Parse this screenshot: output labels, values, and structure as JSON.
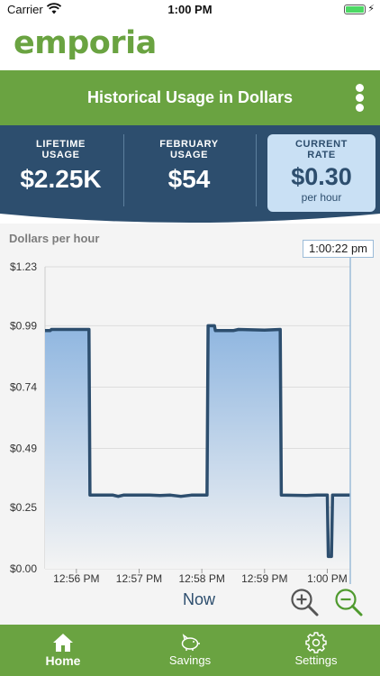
{
  "status_bar": {
    "carrier": "Carrier",
    "time": "1:00 PM"
  },
  "app": {
    "logo": "emporia"
  },
  "header": {
    "title": "Historical Usage in Dollars",
    "menu_icon": "kebab-menu-icon"
  },
  "stats": {
    "lifetime": {
      "label_line1": "LIFETIME",
      "label_line2": "USAGE",
      "value": "$2.25K"
    },
    "month": {
      "label_line1": "FEBRUARY",
      "label_line2": "USAGE",
      "value": "$54"
    },
    "current": {
      "label_line1": "CURRENT",
      "label_line2": "RATE",
      "value": "$0.30",
      "unit": "per hour"
    },
    "colors": {
      "panel": "#2d4e6e",
      "current_bg": "#c9e0f4"
    }
  },
  "chart_data": {
    "type": "line",
    "ylabel": "Dollars per hour",
    "y_ticks": [
      "$1.23",
      "$0.99",
      "$0.74",
      "$0.49",
      "$0.25",
      "$0.00"
    ],
    "y_tick_values": [
      1.23,
      0.99,
      0.74,
      0.49,
      0.25,
      0.0
    ],
    "ylim": [
      0,
      1.23
    ],
    "x_ticks": [
      "12:56 PM",
      "12:57 PM",
      "12:58 PM",
      "12:59 PM",
      "1:00 PM"
    ],
    "x_tick_times": [
      "12:56",
      "12:57",
      "12:58",
      "12:59",
      "13:00"
    ],
    "cursor_time": "1:00:22 pm",
    "grid": true,
    "series": [
      {
        "points": [
          [
            "12:55:30",
            0.97
          ],
          [
            "12:55:35",
            0.97
          ],
          [
            "12:55:36",
            0.975
          ],
          [
            "12:55:50",
            0.975
          ],
          [
            "12:56:12",
            0.975
          ],
          [
            "12:56:13",
            0.3
          ],
          [
            "12:56:35",
            0.3
          ],
          [
            "12:56:40",
            0.295
          ],
          [
            "12:56:45",
            0.3
          ],
          [
            "12:57:10",
            0.3
          ],
          [
            "12:57:20",
            0.298
          ],
          [
            "12:57:30",
            0.3
          ],
          [
            "12:57:40",
            0.295
          ],
          [
            "12:57:50",
            0.3
          ],
          [
            "12:58:05",
            0.3
          ],
          [
            "12:58:06",
            0.99
          ],
          [
            "12:58:12",
            0.99
          ],
          [
            "12:58:13",
            0.97
          ],
          [
            "12:58:30",
            0.97
          ],
          [
            "12:58:35",
            0.975
          ],
          [
            "12:59:00",
            0.972
          ],
          [
            "12:59:15",
            0.975
          ],
          [
            "12:59:16",
            0.3
          ],
          [
            "12:59:40",
            0.298
          ],
          [
            "12:59:50",
            0.3
          ],
          [
            "12:59:58",
            0.3
          ],
          [
            "13:00:00",
            0.3
          ],
          [
            "13:00:01",
            0.05
          ],
          [
            "13:00:04",
            0.05
          ],
          [
            "13:00:05",
            0.3
          ],
          [
            "13:00:22",
            0.3
          ]
        ]
      }
    ],
    "colors": {
      "line": "#2d4e6e",
      "fill_top": "#8fb6e0",
      "fill_bottom": "#f4f4f4",
      "cursor": "#9bbbd8",
      "grid": "#dddddd"
    }
  },
  "controls": {
    "now_label": "Now",
    "zoom_in_icon": "zoom-in-icon",
    "zoom_out_icon": "zoom-out-icon"
  },
  "tabs": [
    {
      "label": "Home",
      "icon": "home-icon",
      "active": true
    },
    {
      "label": "Savings",
      "icon": "piggy-bank-icon",
      "active": false
    },
    {
      "label": "Settings",
      "icon": "gear-icon",
      "active": false
    }
  ],
  "colors": {
    "brand_green": "#6aa341"
  }
}
